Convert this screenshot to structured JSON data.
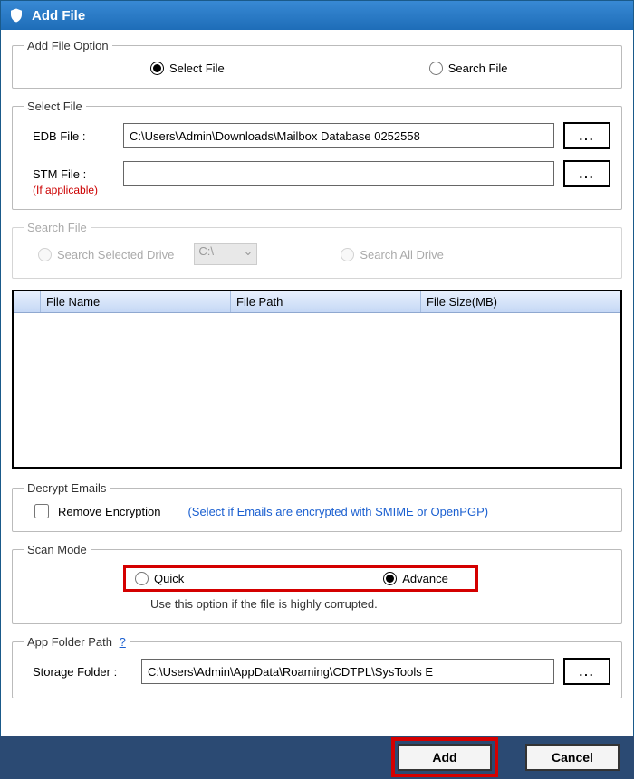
{
  "title": "Add File",
  "addFileOption": {
    "legend": "Add File Option",
    "selectFile": "Select File",
    "searchFile": "Search File"
  },
  "selectFile": {
    "legend": "Select File",
    "edbLabel": "EDB File :",
    "edbValue": "C:\\Users\\Admin\\Downloads\\Mailbox Database 0252558",
    "stmLabel": "STM File :",
    "stmValue": "",
    "note": "(If applicable)",
    "browse": "..."
  },
  "searchFile": {
    "legend": "Search File",
    "selectedDrive": "Search Selected Drive",
    "drive": "C:\\",
    "allDrive": "Search All Drive"
  },
  "table": {
    "cols": [
      "File Name",
      "File Path",
      "File Size(MB)"
    ]
  },
  "decrypt": {
    "legend": "Decrypt Emails",
    "remove": "Remove Encryption",
    "hint": "(Select if Emails are encrypted with SMIME or OpenPGP)"
  },
  "scan": {
    "legend": "Scan Mode",
    "quick": "Quick",
    "advance": "Advance",
    "note": "Use this option if the file is highly corrupted."
  },
  "appFolder": {
    "legend": "App Folder Path",
    "help": "?",
    "label": "Storage Folder   :",
    "value": "C:\\Users\\Admin\\AppData\\Roaming\\CDTPL\\SysTools E",
    "browse": "..."
  },
  "footer": {
    "add": "Add",
    "cancel": "Cancel"
  }
}
